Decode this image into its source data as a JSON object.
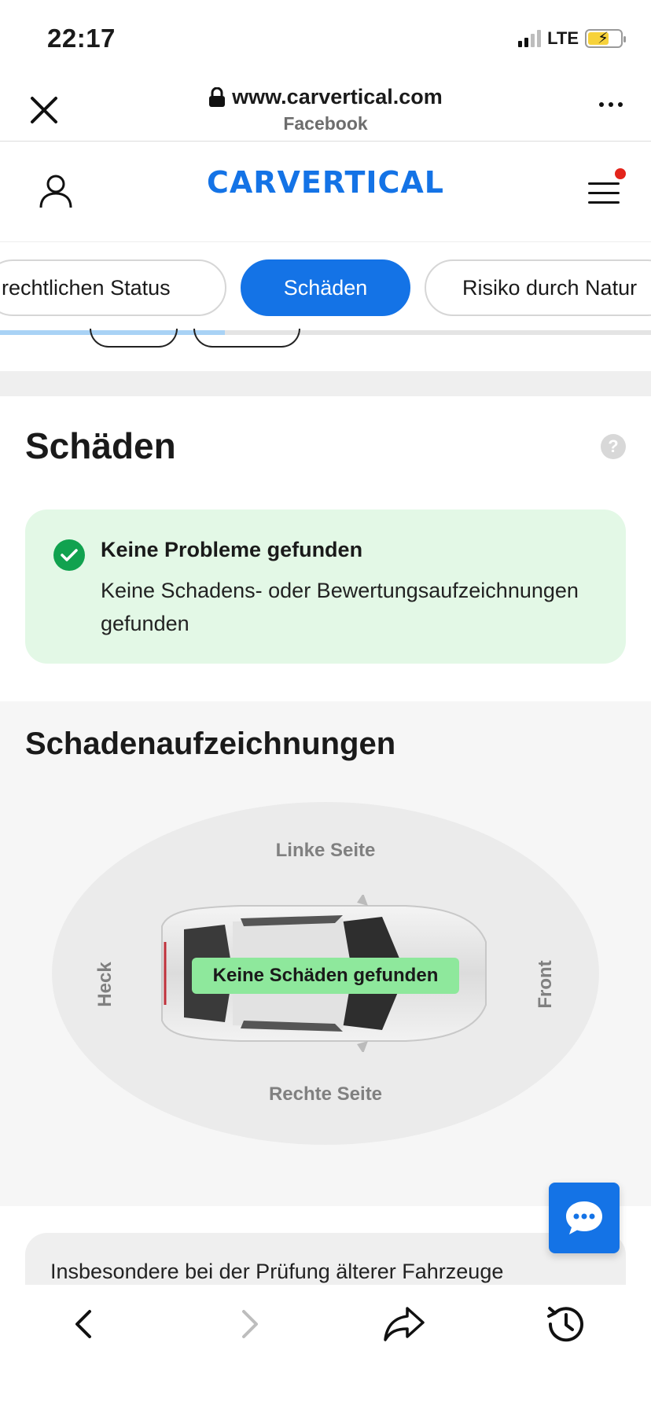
{
  "status_bar": {
    "time": "22:17",
    "network": "LTE"
  },
  "browser": {
    "url": "www.carvertical.com",
    "subtitle": "Facebook"
  },
  "site": {
    "logo": "CARVERTICAL"
  },
  "tabs": [
    {
      "label": "rechtlichen Status",
      "active": false
    },
    {
      "label": "Schäden",
      "active": true
    },
    {
      "label": "Risiko durch Natur",
      "active": false
    }
  ],
  "tab_scroll_progress": 0.345,
  "damage_section": {
    "title": "Schäden",
    "help": "?",
    "status_title": "Keine Probleme gefunden",
    "status_text": "Keine Schadens- oder Bewertungsaufzeichnungen gefunden"
  },
  "records_section": {
    "title": "Schadenaufzeichnungen",
    "left_label": "Linke Seite",
    "right_label": "Rechte Seite",
    "rear_label": "Heck",
    "front_label": "Front",
    "badge": "Keine Schäden gefunden"
  },
  "info_card": {
    "text": "Insbesondere bei der Prüfung älterer Fahrzeuge"
  },
  "colors": {
    "brand": "#1473e6",
    "success": "#11a24f",
    "success_bg": "#e3f8e6",
    "badge": "#8ee89c",
    "notification": "#e3241b"
  }
}
